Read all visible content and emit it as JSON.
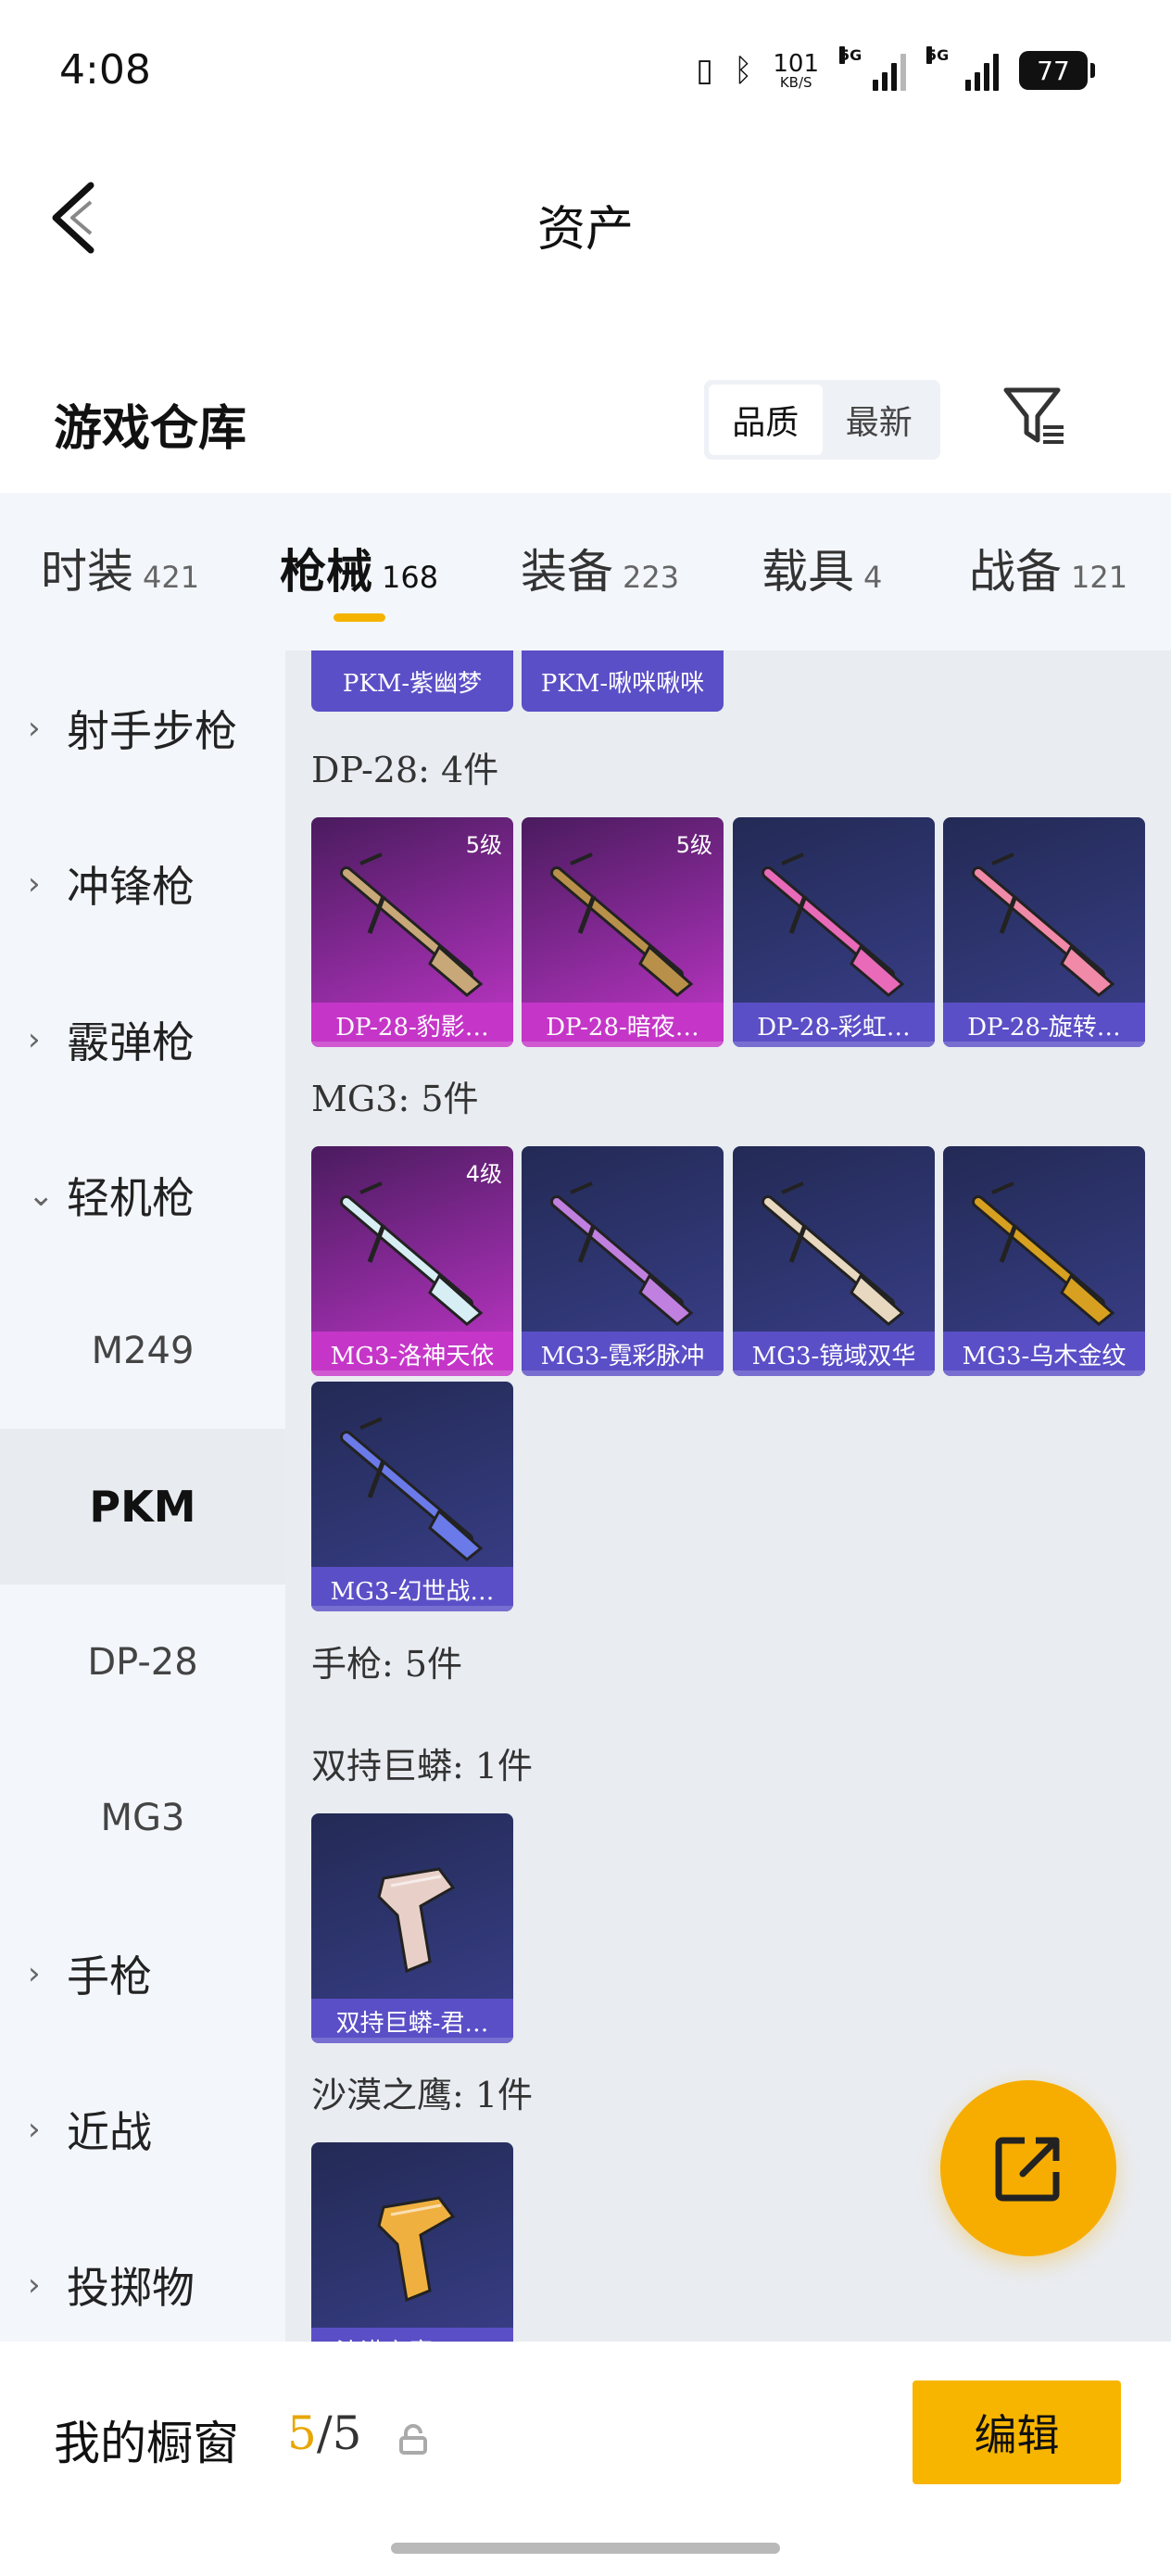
{
  "status_bar": {
    "time": "4:08",
    "net_speed": "101",
    "net_unit": "KB/S",
    "signal1_tag": "5G",
    "signal2_tag": "5G",
    "battery": "77"
  },
  "nav": {
    "title": "资产"
  },
  "warehouse": {
    "title": "游戏仓库",
    "sort_options": [
      "品质",
      "最新"
    ],
    "active_sort": "品质"
  },
  "tabs": [
    {
      "label": "时装",
      "count": "421"
    },
    {
      "label": "枪械",
      "count": "168",
      "active": true
    },
    {
      "label": "装备",
      "count": "223"
    },
    {
      "label": "载具",
      "count": "4"
    },
    {
      "label": "战备",
      "count": "121"
    }
  ],
  "sidebar": {
    "categories": [
      {
        "label": "射手步枪",
        "chevron": "chevron-right"
      },
      {
        "label": "冲锋枪",
        "chevron": "chevron-right"
      },
      {
        "label": "霰弹枪",
        "chevron": "chevron-right"
      },
      {
        "label": "轻机枪",
        "chevron": "chevron-down"
      }
    ],
    "subitems": [
      {
        "label": "M249"
      },
      {
        "label": "PKM",
        "active": true
      },
      {
        "label": "DP-28"
      },
      {
        "label": "MG3"
      }
    ],
    "more_categories": [
      {
        "label": "手枪",
        "chevron": "chevron-right"
      },
      {
        "label": "近战",
        "chevron": "chevron-right"
      },
      {
        "label": "投掷物",
        "chevron": "chevron-right"
      }
    ]
  },
  "content": {
    "partial_items": [
      "PKM-紫幽梦",
      "PKM-啾咪啾咪"
    ],
    "sections": [
      {
        "heading": "DP-28: 4件",
        "items": [
          {
            "name": "DP-28-豹影…",
            "level": "5级",
            "rarity": "purple",
            "accent": "#c8a878"
          },
          {
            "name": "DP-28-暗夜…",
            "level": "5级",
            "rarity": "purple",
            "accent": "#b8904a"
          },
          {
            "name": "DP-28-彩虹…",
            "level": "",
            "rarity": "blue",
            "accent": "#e86ab8"
          },
          {
            "name": "DP-28-旋转…",
            "level": "",
            "rarity": "blue",
            "accent": "#f08aa8"
          }
        ]
      },
      {
        "heading": "MG3: 5件",
        "items": [
          {
            "name": "MG3-洛神天依",
            "level": "4级",
            "rarity": "purple",
            "accent": "#d8eef5"
          },
          {
            "name": "MG3-霓彩脉冲",
            "level": "",
            "rarity": "blue",
            "accent": "#c080e0"
          },
          {
            "name": "MG3-镜域双华",
            "level": "",
            "rarity": "blue",
            "accent": "#e8d8c0"
          },
          {
            "name": "MG3-乌木金纹",
            "level": "",
            "rarity": "blue",
            "accent": "#d8a020"
          },
          {
            "name": "MG3-幻世战…",
            "level": "",
            "rarity": "blue",
            "accent": "#6a7ae8"
          }
        ]
      },
      {
        "heading": "手枪: 5件",
        "items": []
      },
      {
        "heading": "双持巨蟒: 1件",
        "items": [
          {
            "name": "双持巨蟒-君…",
            "level": "",
            "rarity": "blue",
            "accent": "#e8d0c8"
          }
        ]
      },
      {
        "heading": "沙漠之鹰: 1件",
        "items": [
          {
            "name": "沙漠之鹰-云…",
            "level": "",
            "rarity": "blue",
            "accent": "#f0b040"
          }
        ]
      }
    ]
  },
  "bottom": {
    "showcase_label": "我的橱窗",
    "showcase_current": "5",
    "showcase_total": "/5",
    "edit_label": "编辑"
  },
  "colors": {
    "accent": "#f7b500",
    "purple_rarity": "#c536c8",
    "blue_rarity": "#5b4fc7"
  }
}
